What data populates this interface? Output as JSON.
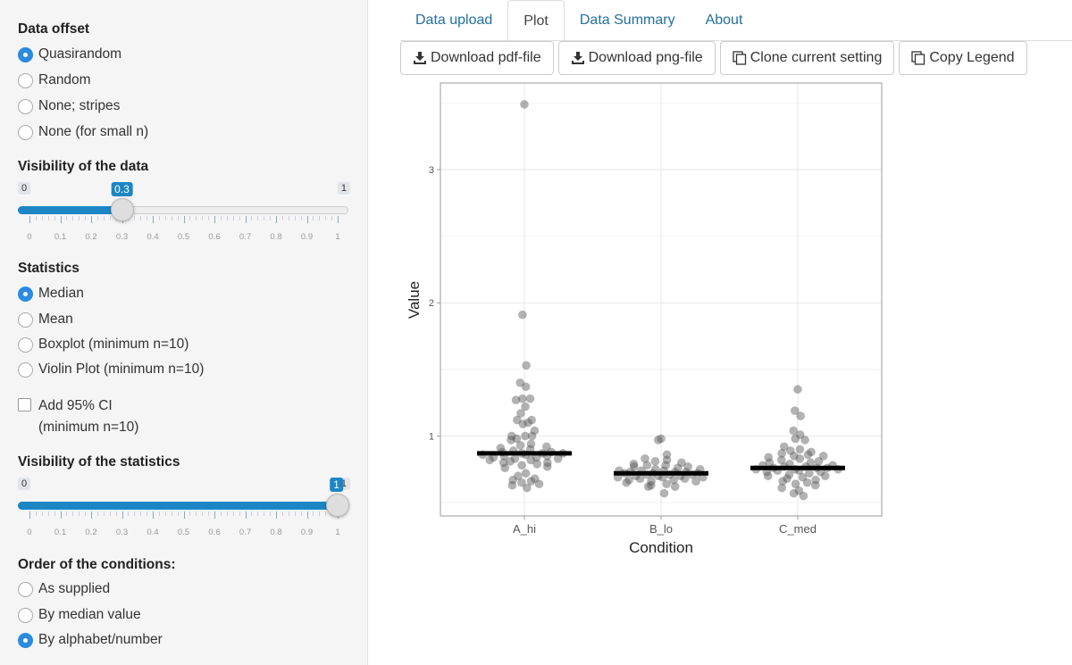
{
  "sidebar": {
    "data_offset": {
      "label": "Data offset",
      "options": [
        "Quasirandom",
        "Random",
        "None; stripes",
        "None (for small n)"
      ],
      "selected": 0
    },
    "data_visibility": {
      "label": "Visibility of the data",
      "min": "0",
      "max": "1",
      "value": "0.3",
      "fraction": 0.3,
      "ticks": [
        "0",
        "0.1",
        "0.2",
        "0.3",
        "0.4",
        "0.5",
        "0.6",
        "0.7",
        "0.8",
        "0.9",
        "1"
      ]
    },
    "statistics": {
      "label": "Statistics",
      "options": [
        "Median",
        "Mean",
        "Boxplot (minimum n=10)",
        "Violin Plot (minimum n=10)"
      ],
      "selected": 0
    },
    "ci": {
      "label": "Add 95% CI",
      "sublabel": "(minimum n=10)",
      "checked": false
    },
    "stats_visibility": {
      "label": "Visibility of the statistics",
      "min": "0",
      "max": "1",
      "value": "1",
      "fraction": 1.0,
      "ticks": [
        "0",
        "0.1",
        "0.2",
        "0.3",
        "0.4",
        "0.5",
        "0.6",
        "0.7",
        "0.8",
        "0.9",
        "1"
      ]
    },
    "order": {
      "label": "Order of the conditions:",
      "options": [
        "As supplied",
        "By median value",
        "By alphabet/number"
      ],
      "selected": 2
    }
  },
  "tabs": [
    {
      "label": "Data upload"
    },
    {
      "label": "Plot",
      "active": true
    },
    {
      "label": "Data Summary"
    },
    {
      "label": "About"
    }
  ],
  "buttons": [
    {
      "label": "Download pdf-file",
      "icon": "download-icon"
    },
    {
      "label": "Download png-file",
      "icon": "download-icon"
    },
    {
      "label": "Clone current setting",
      "icon": "copy-icon"
    },
    {
      "label": "Copy Legend",
      "icon": "copy-icon"
    }
  ],
  "colors": {
    "accent": "#1c86c5",
    "link": "#23709e",
    "dots": "#555555",
    "median": "#000000"
  },
  "chart_data": {
    "type": "scatter",
    "xlabel": "Condition",
    "ylabel": "Value",
    "categories": [
      "A_hi",
      "B_lo",
      "C_med"
    ],
    "ylim": [
      0.4,
      3.65
    ],
    "yticks": [
      "1",
      "2",
      "3"
    ],
    "grid": true,
    "medians": [
      0.87,
      0.72,
      0.76
    ],
    "series": [
      {
        "values": [
          3.49,
          1.91,
          1.53,
          1.4,
          1.37,
          1.28,
          1.28,
          1.27,
          1.22,
          1.17,
          1.12,
          1.12,
          1.1,
          1.09,
          1.04,
          1.0,
          1.0,
          0.98,
          1.0,
          0.97,
          0.94,
          0.93,
          0.92,
          0.91,
          0.9,
          0.89,
          0.88,
          0.88,
          0.87,
          0.87,
          0.87,
          0.86,
          0.86,
          0.85,
          0.85,
          0.84,
          0.84,
          0.83,
          0.83,
          0.82,
          0.82,
          0.81,
          0.8,
          0.8,
          0.79,
          0.78,
          0.77,
          0.76,
          0.72,
          0.7,
          0.68,
          0.67,
          0.66,
          0.65,
          0.64,
          0.63,
          0.61
        ]
      },
      {
        "values": [
          0.98,
          0.97,
          0.86,
          0.83,
          0.82,
          0.81,
          0.8,
          0.79,
          0.78,
          0.78,
          0.77,
          0.77,
          0.76,
          0.75,
          0.75,
          0.74,
          0.74,
          0.74,
          0.73,
          0.73,
          0.73,
          0.72,
          0.72,
          0.72,
          0.71,
          0.71,
          0.71,
          0.7,
          0.7,
          0.7,
          0.69,
          0.69,
          0.69,
          0.68,
          0.68,
          0.67,
          0.67,
          0.66,
          0.66,
          0.65,
          0.64,
          0.63,
          0.62,
          0.62,
          0.57
        ]
      },
      {
        "values": [
          1.35,
          1.19,
          1.15,
          1.04,
          1.01,
          0.98,
          0.97,
          0.92,
          0.9,
          0.89,
          0.88,
          0.87,
          0.86,
          0.85,
          0.85,
          0.84,
          0.83,
          0.82,
          0.81,
          0.8,
          0.8,
          0.79,
          0.78,
          0.78,
          0.77,
          0.77,
          0.76,
          0.76,
          0.76,
          0.75,
          0.75,
          0.75,
          0.74,
          0.74,
          0.73,
          0.73,
          0.72,
          0.71,
          0.7,
          0.7,
          0.69,
          0.68,
          0.67,
          0.66,
          0.65,
          0.64,
          0.63,
          0.61,
          0.59,
          0.57,
          0.55
        ]
      }
    ]
  }
}
